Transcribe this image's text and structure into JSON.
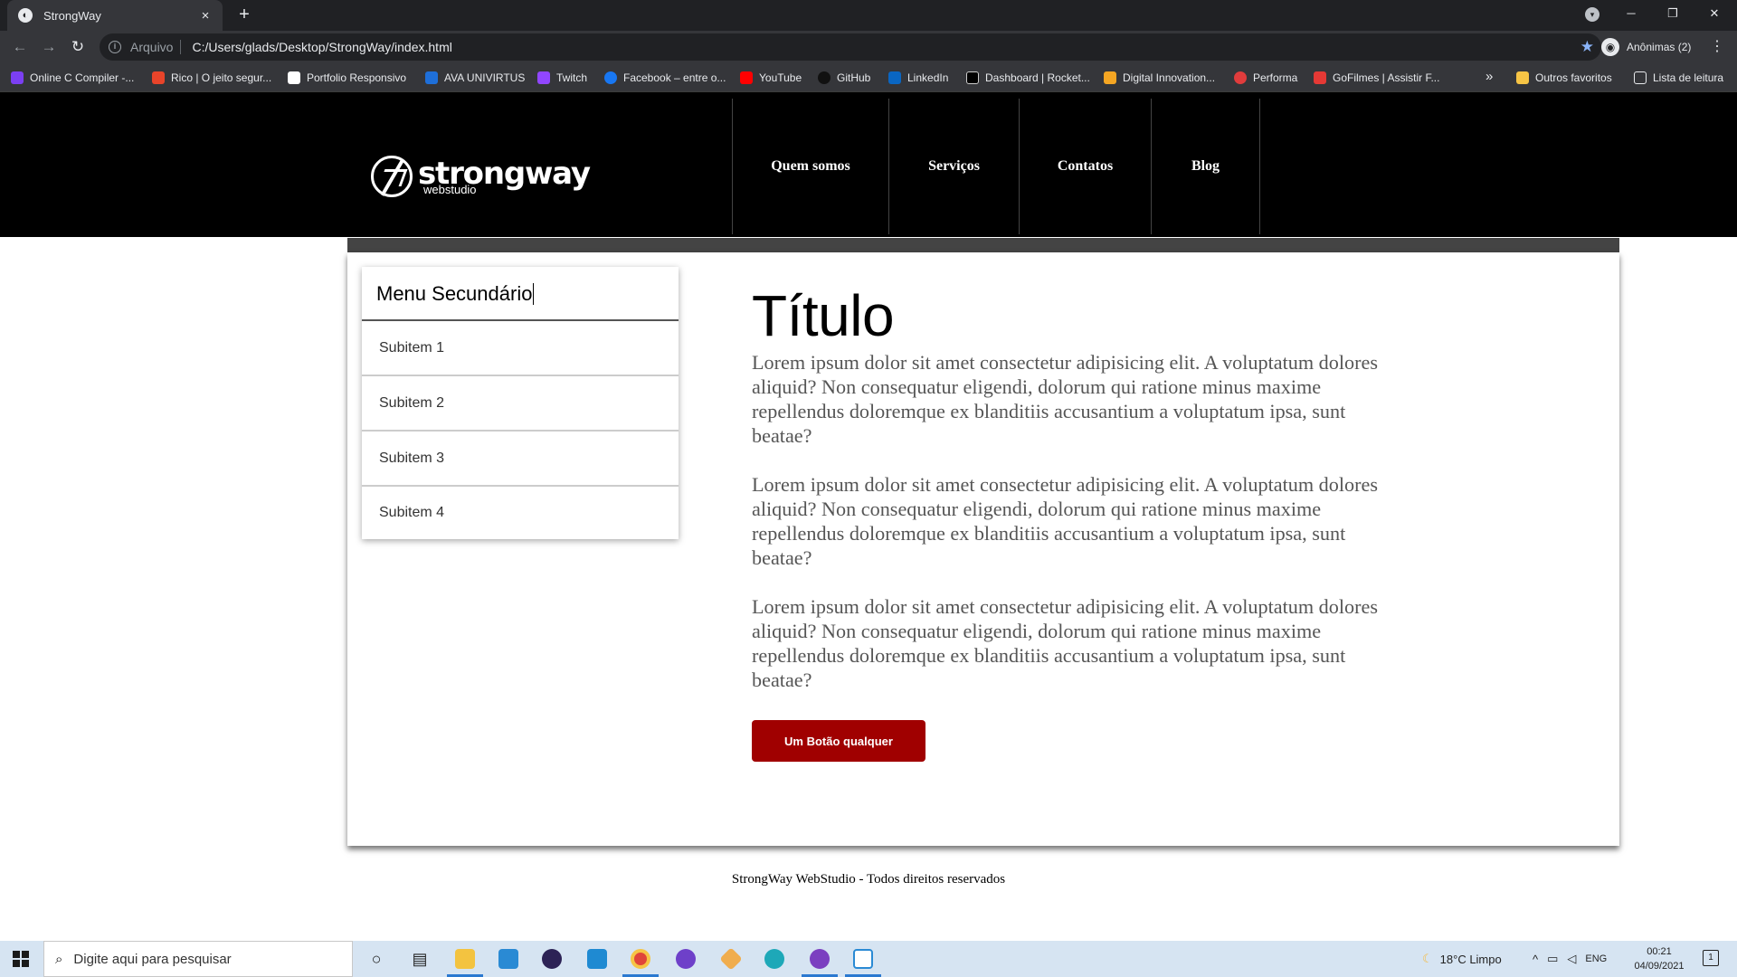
{
  "browser": {
    "tab_title": "StrongWay",
    "tab_close": "×",
    "new_tab": "+",
    "minimize": "─",
    "restore": "❐",
    "close": "✕",
    "protocol_label": "Arquivo",
    "url": "C:/Users/glads/Desktop/StrongWay/index.html",
    "profile_label": "Anônimas (2)",
    "bookmarks": [
      {
        "label": "Online C Compiler -...",
        "color": "#7b3ff2"
      },
      {
        "label": "Rico | O jeito segur...",
        "color": "#e8442a"
      },
      {
        "label": "Portfolio Responsivo",
        "color": "#ffffff"
      },
      {
        "label": "AVA UNIVIRTUS",
        "color": "#1e6fd9"
      },
      {
        "label": "Twitch",
        "color": "#9146ff"
      },
      {
        "label": "Facebook – entre o...",
        "color": "#1877f2"
      },
      {
        "label": "YouTube",
        "color": "#ff0000"
      },
      {
        "label": "GitHub",
        "color": "#111111"
      },
      {
        "label": "LinkedIn",
        "color": "#0a66c2"
      },
      {
        "label": "Dashboard | Rocket...",
        "color": "#000000"
      },
      {
        "label": "Digital Innovation...",
        "color": "#f5a623"
      },
      {
        "label": "Performa",
        "color": "#e03c3c"
      },
      {
        "label": "GoFilmes | Assistir F...",
        "color": "#e53935"
      }
    ],
    "bookmarks_more": "»",
    "other_bookmarks": "Outros favoritos",
    "reading_list": "Lista de leitura"
  },
  "site": {
    "logo_name": "strongway",
    "logo_sub": "webstudio",
    "nav": [
      {
        "label": "Quem somos"
      },
      {
        "label": "Serviços"
      },
      {
        "label": "Contatos"
      },
      {
        "label": "Blog"
      }
    ],
    "submenu": {
      "title": "Menu Secundário",
      "items": [
        "Subitem 1",
        "Subitem 2",
        "Subitem 3",
        "Subitem 4"
      ]
    },
    "main": {
      "title": "Título",
      "paragraphs": [
        "Lorem ipsum dolor sit amet consectetur adipisicing elit. A voluptatum dolores aliquid? Non consequatur eligendi, dolorum qui ratione minus maxime repellendus doloremque ex blanditiis accusantium a voluptatum ipsa, sunt beatae?",
        "Lorem ipsum dolor sit amet consectetur adipisicing elit. A voluptatum dolores aliquid? Non consequatur eligendi, dolorum qui ratione minus maxime repellendus doloremque ex blanditiis accusantium a voluptatum ipsa, sunt beatae?",
        "Lorem ipsum dolor sit amet consectetur adipisicing elit. A voluptatum dolores aliquid? Non consequatur eligendi, dolorum qui ratione minus maxime repellendus doloremque ex blanditiis accusantium a voluptatum ipsa, sunt beatae?"
      ],
      "button_label": "Um Botão qualquer"
    },
    "footer": "StrongWay WebStudio - Todos direitos reservados",
    "accent_color": "#a00000"
  },
  "taskbar": {
    "search_placeholder": "Digite aqui para pesquisar",
    "weather": "18°C  Limpo",
    "language": "ENG",
    "time": "00:21",
    "date": "04/09/2021",
    "notification_count": "1"
  }
}
